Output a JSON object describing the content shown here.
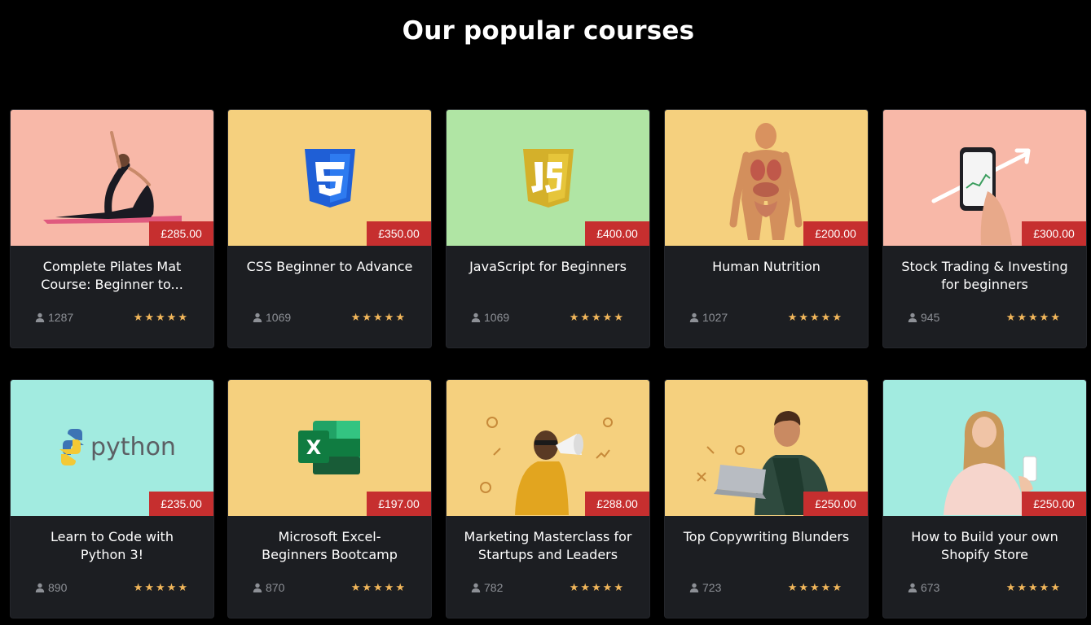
{
  "section_title": "Our popular courses",
  "colors": {
    "background": "#000000",
    "card": "#1c1e22",
    "price_badge": "#c62f2f",
    "star": "#f2b75b"
  },
  "courses": [
    {
      "title": "Complete Pilates Mat Course: Beginner to...",
      "price": "£285.00",
      "students": "1287",
      "rating": 5,
      "stars": "★★★★★",
      "thumb_color": "#f8b8a8",
      "thumb_icon": "pilates-person-icon"
    },
    {
      "title": "CSS Beginner to Advance",
      "price": "£350.00",
      "students": "1069",
      "rating": 5,
      "stars": "★★★★★",
      "thumb_color": "#f5d07e",
      "thumb_icon": "css3-logo-icon"
    },
    {
      "title": "JavaScript for Beginners",
      "price": "£400.00",
      "students": "1069",
      "rating": 5,
      "stars": "★★★★★",
      "thumb_color": "#b0e5a4",
      "thumb_icon": "js-logo-icon"
    },
    {
      "title": "Human Nutrition",
      "price": "£200.00",
      "students": "1027",
      "rating": 5,
      "stars": "★★★★★",
      "thumb_color": "#f5d07e",
      "thumb_icon": "human-anatomy-icon"
    },
    {
      "title": "Stock Trading & Investing for beginners",
      "price": "£300.00",
      "students": "945",
      "rating": 5,
      "stars": "★★★★★",
      "thumb_color": "#f8b8a8",
      "thumb_icon": "phone-chart-icon"
    },
    {
      "title": "Learn to Code with Python 3!",
      "price": "£235.00",
      "students": "890",
      "rating": 5,
      "stars": "★★★★★",
      "thumb_color": "#a2ebe0",
      "thumb_icon": "python-logo-icon",
      "thumb_text": "python"
    },
    {
      "title": "Microsoft Excel- Beginners Bootcamp",
      "price": "£197.00",
      "students": "870",
      "rating": 5,
      "stars": "★★★★★",
      "thumb_color": "#f5d07e",
      "thumb_icon": "excel-logo-icon",
      "thumb_text": "X"
    },
    {
      "title": "Marketing Masterclass for Startups and Leaders",
      "price": "£288.00",
      "students": "782",
      "rating": 5,
      "stars": "★★★★★",
      "thumb_color": "#f5d07e",
      "thumb_icon": "megaphone-person-icon"
    },
    {
      "title": "Top Copywriting Blunders",
      "price": "£250.00",
      "students": "723",
      "rating": 5,
      "stars": "★★★★★",
      "thumb_color": "#f5d07e",
      "thumb_icon": "laptop-person-icon"
    },
    {
      "title": "How to Build your own Shopify Store",
      "price": "£250.00",
      "students": "673",
      "rating": 5,
      "stars": "★★★★★",
      "thumb_color": "#a2ebe0",
      "thumb_icon": "phone-woman-icon"
    }
  ]
}
